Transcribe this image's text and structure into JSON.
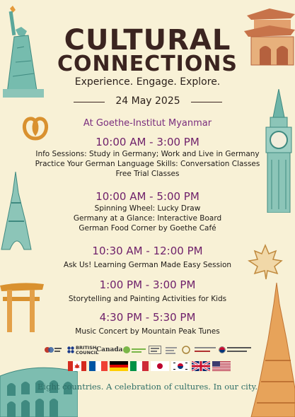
{
  "title_line1": "CULTURAL",
  "title_line2": "CONNECTIONS",
  "tagline": "Experience. Engage. Explore.",
  "date": "24 May 2025",
  "venue": "At Goethe-Institut Myanmar",
  "schedule": [
    {
      "time": "10:00 AM - 3:00 PM",
      "items": [
        "Info Sessions: Study in Germany; Work and Live in Germany",
        "Practice Your German Language Skills: Conversation Classes",
        "Free Trial Classes"
      ]
    },
    {
      "time": "10:00 AM - 5:00 PM",
      "items": [
        "Spinning Wheel: Lucky Draw",
        "Germany at a Glance: Interactive Board",
        "German Food Corner by Goethe Café"
      ]
    },
    {
      "time": "10:30 AM - 12:00 PM",
      "items": [
        "Ask Us! Learning German Made Easy Session"
      ]
    },
    {
      "time": "1:00 PM - 3:00 PM",
      "items": [
        "Storytelling and Painting Activities for Kids"
      ]
    },
    {
      "time": "4:30 PM - 5:30 PM",
      "items": [
        "Music Concert by Mountain Peak Tunes"
      ]
    }
  ],
  "partners": {
    "british_council": "BRITISH COUNCIL",
    "canada": "Canada"
  },
  "flags": [
    "canada-flag",
    "france-flag",
    "germany-flag",
    "italy-flag",
    "japan-flag",
    "korea-flag",
    "uk-flag",
    "usa-flag"
  ],
  "footer": "Eight countries. A celebration of cultures. In our city.",
  "colors": {
    "background": "#f8f1d6",
    "title": "#3b2420",
    "time": "#6e1f6a",
    "footer": "#2e6e66"
  }
}
